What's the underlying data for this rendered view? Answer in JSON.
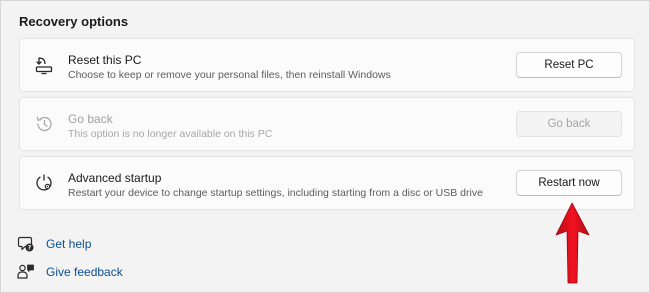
{
  "section_title": "Recovery options",
  "cards": [
    {
      "title": "Reset this PC",
      "description": "Choose to keep or remove your personal files, then reinstall Windows",
      "button": "Reset PC",
      "icon": "reset-pc-icon",
      "enabled": true
    },
    {
      "title": "Go back",
      "description": "This option is no longer available on this PC",
      "button": "Go back",
      "icon": "history-icon",
      "enabled": false
    },
    {
      "title": "Advanced startup",
      "description": "Restart your device to change startup settings, including starting from a disc or USB drive",
      "button": "Restart now",
      "icon": "advanced-startup-icon",
      "enabled": true
    }
  ],
  "links": [
    {
      "label": "Get help",
      "icon": "help-icon"
    },
    {
      "label": "Give feedback",
      "icon": "feedback-icon"
    }
  ],
  "colors": {
    "link": "#0a4f96",
    "annotation_arrow": "#e8101c",
    "background": "#f3f3f3",
    "card": "#fbfbfb"
  }
}
